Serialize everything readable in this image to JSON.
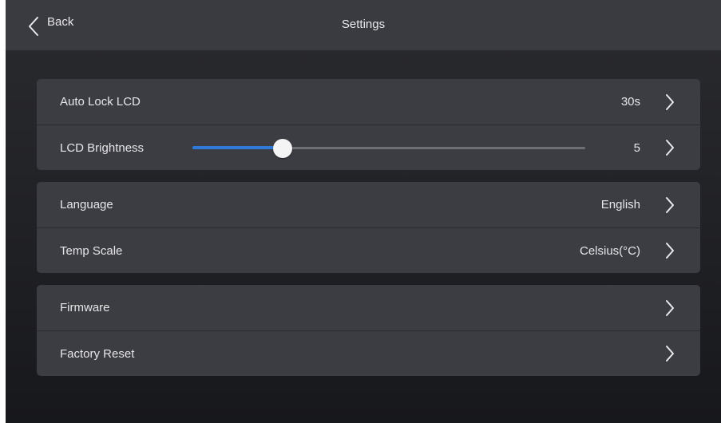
{
  "header": {
    "back_label": "Back",
    "title": "Settings"
  },
  "groups": [
    {
      "rows": [
        {
          "label": "Auto Lock LCD",
          "value": "30s"
        },
        {
          "label": "LCD Brightness",
          "value": "5"
        }
      ]
    },
    {
      "rows": [
        {
          "label": "Language",
          "value": "English"
        },
        {
          "label": "Temp Scale",
          "value": "Celsius(°C)"
        }
      ]
    },
    {
      "rows": [
        {
          "label": "Firmware",
          "value": ""
        },
        {
          "label": "Factory Reset",
          "value": ""
        }
      ]
    }
  ],
  "brightness_slider": {
    "fraction": 0.23
  },
  "icons": {
    "back": "chevron-left-icon",
    "row": "chevron-right-icon"
  },
  "colors": {
    "accent": "#2f79d9",
    "thumb": "#f4f4f4"
  }
}
